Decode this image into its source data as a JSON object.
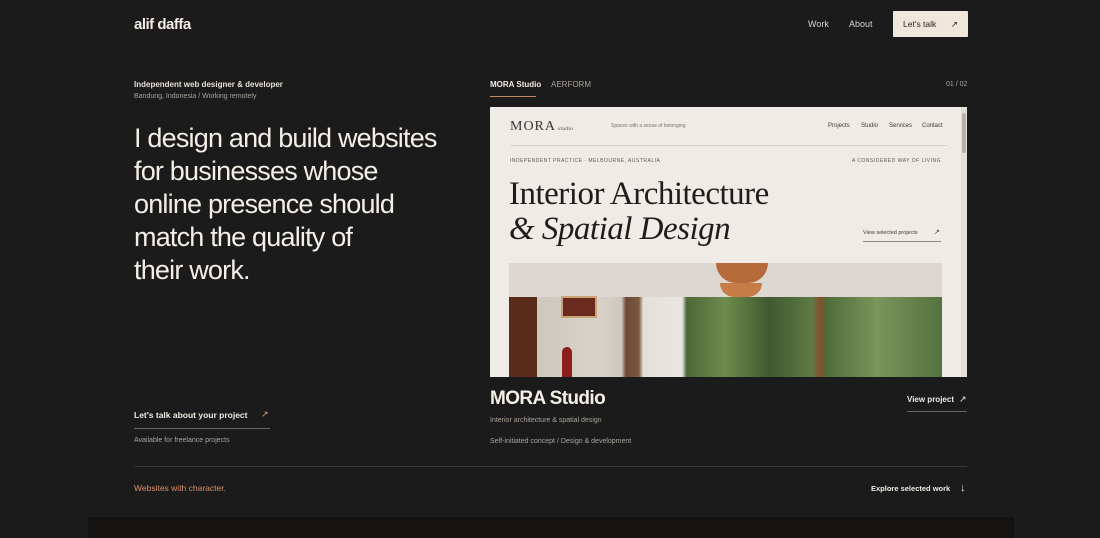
{
  "header": {
    "logo": "alif daffa",
    "nav": [
      {
        "label": "Work"
      },
      {
        "label": "About"
      }
    ],
    "cta_label": "Let's talk",
    "cta_icon": "arrow-up-right-icon"
  },
  "hero": {
    "eyebrow": "Independent web designer & developer",
    "location": "Bandung, Indonesia / Working remotely",
    "headline_lines": [
      "I design and build websites",
      "for businesses whose",
      "online presence should",
      "match the quality of",
      "their work."
    ],
    "cta_label": "Let's talk about your project",
    "availability": "Available for freelance projects"
  },
  "showcase": {
    "tabs": [
      {
        "label": "MORA Studio",
        "active": true
      },
      {
        "label": "AERFORM",
        "active": false
      }
    ],
    "counter": "01 / 02",
    "preview": {
      "logo": "MORA",
      "logo_suffix": "studio",
      "tagline": "Spaces with a sense of belonging",
      "nav": [
        "Projects",
        "Studio",
        "Services",
        "Contact"
      ],
      "eyebrow_left": "INDEPENDENT PRACTICE · MELBOURNE, AUSTRALIA",
      "eyebrow_right": "A CONSIDERED WAY OF LIVING",
      "heading_line1": "Interior Architecture",
      "heading_line2": "& Spatial Design",
      "view_link": "View selected projects"
    },
    "project_title": "MORA Studio",
    "project_subtitle": "Interior architecture & spatial design",
    "project_meta": "Self-initiated concept / Design & development",
    "view_project_label": "View project"
  },
  "footer": {
    "tagline": "Websites with character.",
    "explore_label": "Explore selected work",
    "explore_icon": "arrow-down-icon"
  },
  "colors": {
    "background": "#1c1b1b",
    "accent": "#d8936a",
    "cta_background": "#efe6dc"
  }
}
